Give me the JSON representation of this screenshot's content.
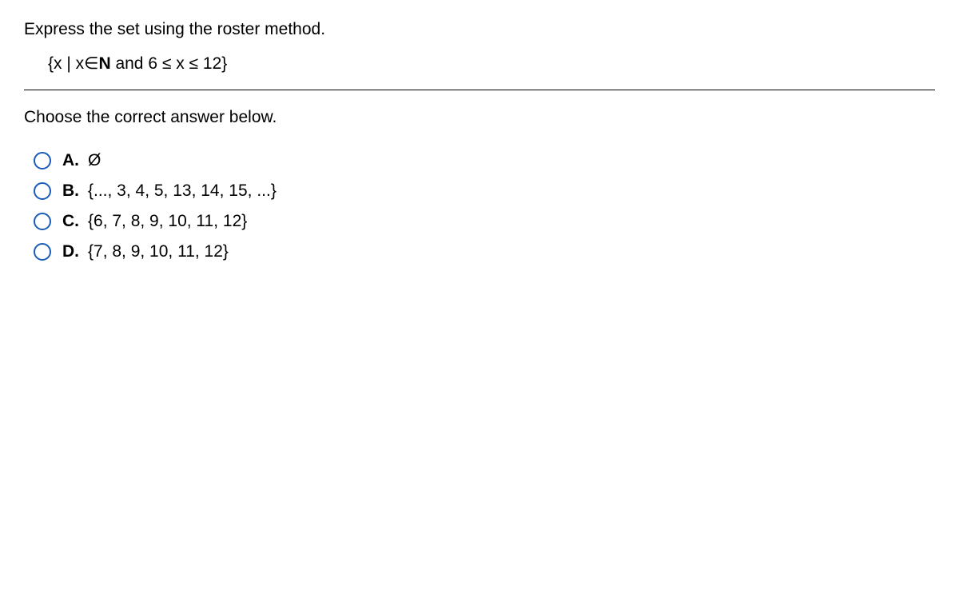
{
  "question": {
    "prompt": "Express the set using the roster method.",
    "expression_prefix": "{x | x",
    "expression_element": "∈",
    "expression_set": "N",
    "expression_and": " and ",
    "expression_rest": "6 ≤ x ≤ 12}",
    "instruction": "Choose the correct answer below."
  },
  "options": [
    {
      "label": "A.",
      "text": "Ø"
    },
    {
      "label": "B.",
      "text": "{..., 3, 4, 5, 13, 14, 15, ...}"
    },
    {
      "label": "C.",
      "text": "{6, 7, 8, 9, 10, 11, 12}"
    },
    {
      "label": "D.",
      "text": "{7, 8, 9, 10, 11, 12}"
    }
  ]
}
